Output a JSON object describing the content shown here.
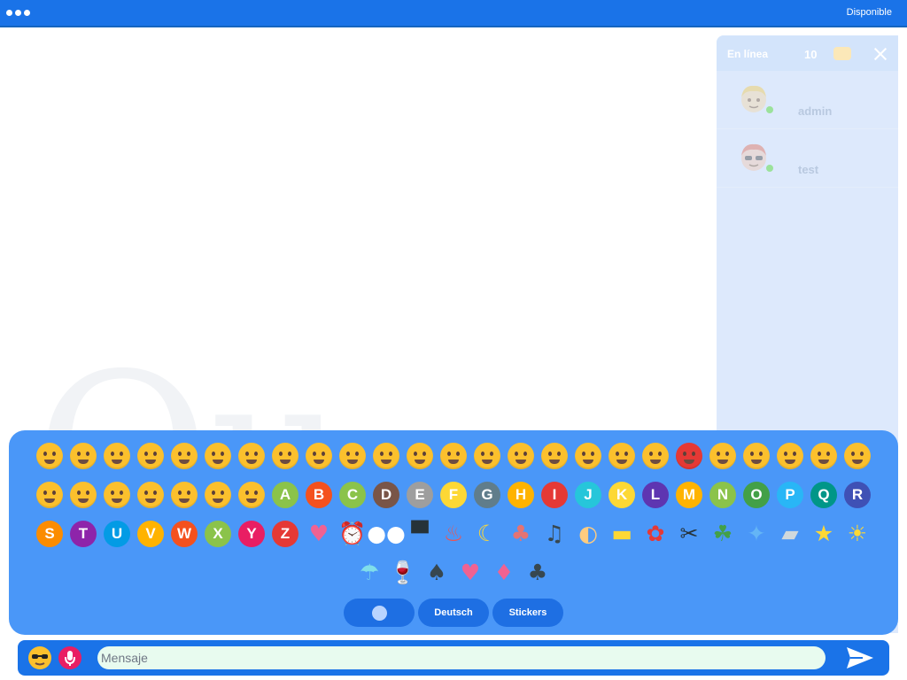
{
  "topbar": {
    "status": "Disponible"
  },
  "online": {
    "title": "En línea",
    "count": "10",
    "users": [
      {
        "name": "admin"
      },
      {
        "name": "test"
      }
    ]
  },
  "emoji_panel": {
    "rows": [
      [
        "smile",
        "shocked",
        "bandaged",
        "sweat",
        "confounded",
        "confused",
        "crying",
        "disappointed",
        "dizzy",
        "flushed",
        "frowning",
        "grimacing",
        "grinning",
        "halo",
        "heart-eyes",
        "kissing",
        "laughing",
        "open-mouth",
        "pensive",
        "angry",
        "relieved",
        "rolling-eyes",
        "slight-smile",
        "smirk",
        "sunglasses"
      ],
      [
        "tongue",
        "wink-tongue",
        "unamused",
        "weary",
        "wink",
        "worried",
        "zipper",
        "A",
        "B",
        "C",
        "D",
        "E",
        "F",
        "G",
        "H",
        "I",
        "J",
        "K",
        "L",
        "M",
        "N",
        "O",
        "P",
        "Q",
        "R"
      ],
      [
        "S",
        "T",
        "U",
        "V",
        "W",
        "X",
        "Y",
        "Z",
        "two-hearts",
        "alarm-clock",
        "eyes",
        "top-hat",
        "hot-springs",
        "crescent-moon",
        "mushroom",
        "musical-note",
        "palette",
        "pill",
        "rose",
        "scissors",
        "shamrock",
        "sparkle",
        "smoking",
        "star",
        "sun"
      ],
      [
        "umbrella",
        "wine",
        "spade",
        "heart",
        "diamond",
        "club"
      ]
    ],
    "letter_colors": {
      "A": "#8bc34a",
      "B": "#f4511e",
      "C": "#8bc34a",
      "D": "#795548",
      "E": "#9e9e9e",
      "F": "#fdd835",
      "G": "#607d8b",
      "H": "#ffb300",
      "I": "#e53935",
      "J": "#26c6da",
      "K": "#fdd835",
      "L": "#5e35b1",
      "M": "#ffb300",
      "N": "#8bc34a",
      "O": "#43a047",
      "P": "#29b6f6",
      "Q": "#009688",
      "R": "#3f51b5",
      "S": "#fb8c00",
      "T": "#8e24aa",
      "U": "#039be5",
      "V": "#ffb300",
      "W": "#f4511e",
      "X": "#8bc34a",
      "Y": "#e91e63",
      "Z": "#e53935"
    },
    "tabs": {
      "lang": "Deutsch",
      "stickers": "Stickers"
    }
  },
  "composer": {
    "placeholder": "Mensaje"
  },
  "colors": {
    "topbar": "#1a73e8",
    "panel": "#4a97f8",
    "tab": "#1e6fe3",
    "input_bg": "#e8fbef"
  }
}
